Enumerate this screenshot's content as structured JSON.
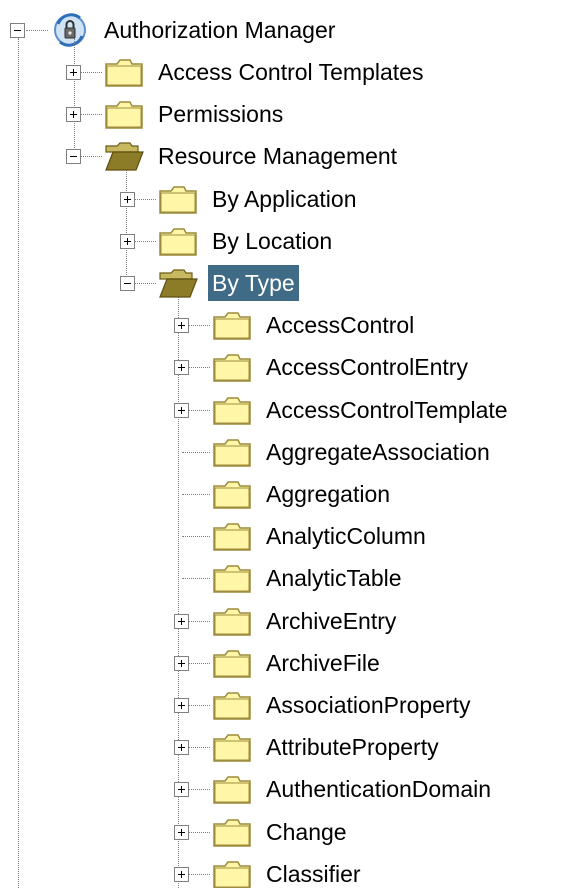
{
  "tree": {
    "root": {
      "label": "Authorization Manager",
      "icon": "authorization-manager-icon",
      "expanded": true
    },
    "nodes": [
      {
        "label": "Access Control Templates",
        "level": 1,
        "toggle": "plus",
        "folder": "closed"
      },
      {
        "label": "Permissions",
        "level": 1,
        "toggle": "plus",
        "folder": "closed"
      },
      {
        "label": "Resource Management",
        "level": 1,
        "toggle": "minus",
        "folder": "open"
      },
      {
        "label": "By Application",
        "level": 2,
        "toggle": "plus",
        "folder": "closed"
      },
      {
        "label": "By Location",
        "level": 2,
        "toggle": "plus",
        "folder": "closed"
      },
      {
        "label": "By Type",
        "level": 2,
        "toggle": "minus",
        "folder": "open",
        "selected": true
      },
      {
        "label": "AccessControl",
        "level": 3,
        "toggle": "plus",
        "folder": "closed"
      },
      {
        "label": "AccessControlEntry",
        "level": 3,
        "toggle": "plus",
        "folder": "closed"
      },
      {
        "label": "AccessControlTemplate",
        "level": 3,
        "toggle": "plus",
        "folder": "closed"
      },
      {
        "label": "AggregateAssociation",
        "level": 3,
        "toggle": "none",
        "folder": "closed"
      },
      {
        "label": "Aggregation",
        "level": 3,
        "toggle": "none",
        "folder": "closed"
      },
      {
        "label": "AnalyticColumn",
        "level": 3,
        "toggle": "none",
        "folder": "closed"
      },
      {
        "label": "AnalyticTable",
        "level": 3,
        "toggle": "none",
        "folder": "closed"
      },
      {
        "label": "ArchiveEntry",
        "level": 3,
        "toggle": "plus",
        "folder": "closed"
      },
      {
        "label": "ArchiveFile",
        "level": 3,
        "toggle": "plus",
        "folder": "closed"
      },
      {
        "label": "AssociationProperty",
        "level": 3,
        "toggle": "plus",
        "folder": "closed"
      },
      {
        "label": "AttributeProperty",
        "level": 3,
        "toggle": "plus",
        "folder": "closed"
      },
      {
        "label": "AuthenticationDomain",
        "level": 3,
        "toggle": "plus",
        "folder": "closed"
      },
      {
        "label": "Change",
        "level": 3,
        "toggle": "plus",
        "folder": "closed"
      },
      {
        "label": "Classifier",
        "level": 3,
        "toggle": "plus",
        "folder": "closed"
      }
    ],
    "colors": {
      "selection_bg": "#3f6b86",
      "folder_fill": "#fff6a8",
      "folder_stroke": "#9c8c3c",
      "open_folder_fill": "#8c7c28",
      "tree_line": "#808080"
    }
  }
}
